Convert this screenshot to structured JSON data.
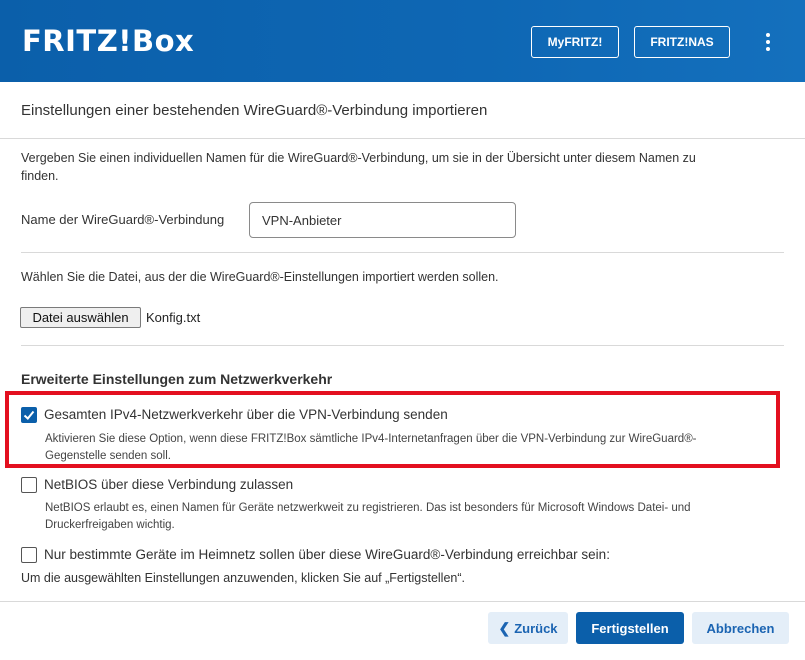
{
  "header": {
    "logo": "FRITZ!Box",
    "myfritz_label": "MyFRITZ!",
    "fritznas_label": "FRITZ!NAS"
  },
  "page_title": "Einstellungen einer bestehenden WireGuard®-Verbindung importieren",
  "name_section": {
    "description_line1": "Vergeben Sie einen individuellen Namen für die WireGuard®-Verbindung, um sie in der Übersicht unter diesem Namen zu",
    "description_line2": "finden.",
    "label": "Name der WireGuard®-Verbindung",
    "value": "VPN-Anbieter"
  },
  "file_section": {
    "description": "Wählen Sie die Datei, aus der die WireGuard®-Einstellungen importiert werden sollen.",
    "button_label": "Datei auswählen",
    "file_name": "Konfig.txt"
  },
  "advanced": {
    "title": "Erweiterte Einstellungen zum Netzwerkverkehr",
    "options": [
      {
        "label": "Gesamten IPv4-Netzwerkverkehr über die VPN-Verbindung senden",
        "checked": true,
        "desc_line1": "Aktivieren Sie diese Option, wenn diese FRITZ!Box sämtliche IPv4-Internetanfragen über die VPN-Verbindung zur WireGuard®-",
        "desc_line2": "Gegenstelle senden soll."
      },
      {
        "label": "NetBIOS über diese Verbindung zulassen",
        "checked": false,
        "desc_line1": "NetBIOS erlaubt es, einen Namen für Geräte netzwerkweit zu registrieren. Das ist besonders für Microsoft Windows Datei- und",
        "desc_line2": "Druckerfreigaben wichtig."
      },
      {
        "label": "Nur bestimmte Geräte im Heimnetz sollen über diese WireGuard®-Verbindung erreichbar sein:",
        "checked": false
      }
    ]
  },
  "instruction": "Um die ausgewählten Einstellungen anzuwenden, klicken Sie auf „Fertigstellen“.",
  "footer": {
    "back_label": "Zurück",
    "finish_label": "Fertigstellen",
    "cancel_label": "Abbrechen"
  },
  "colors": {
    "brand_blue": "#0b5faa",
    "highlight_red": "#e3101f"
  }
}
